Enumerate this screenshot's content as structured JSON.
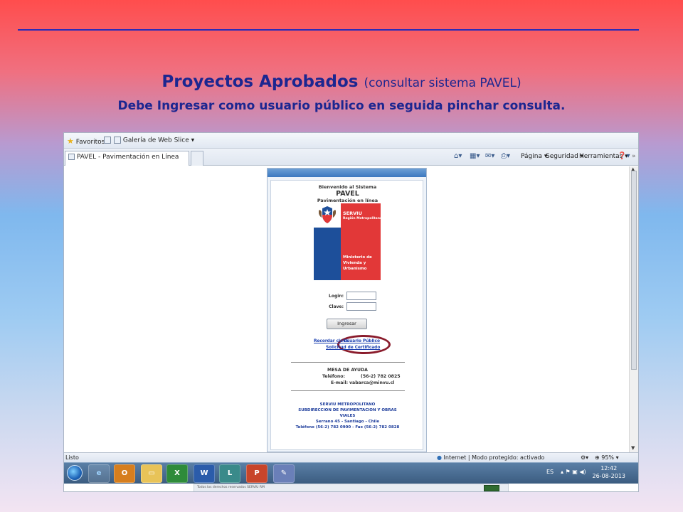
{
  "slide": {
    "title": "Proyectos Aprobados",
    "title_suffix": "(consultar sistema PAVEL)",
    "subtitle": "Debe Ingresar como usuario público  en seguida pinchar consulta."
  },
  "browser": {
    "favorites_label": "Favoritos",
    "web_slice_label": "Galería de Web Slice",
    "tab_title": "PAVEL - Pavimentación en Línea",
    "commands": {
      "pagina": "Página",
      "seguridad": "Seguridad",
      "herramientas": "Herramientas"
    },
    "status_left": "Listo",
    "status_zone": "Internet | Modo protegido: activado",
    "zoom": "95%"
  },
  "page": {
    "welcome": "Bienvenido al Sistema",
    "system_name": "PAVEL",
    "system_desc": "Pavimentación en línea",
    "logo": {
      "org": "SERVIU",
      "region": "Región Metropolitana",
      "ministry": "Ministerio de Vivienda y Urbanismo",
      "colors": {
        "blue": "#1d4f9a",
        "red": "#e23838"
      }
    },
    "login_label": "Login:",
    "password_label": "Clave:",
    "submit_label": "Ingresar",
    "links": {
      "recordar": "Recordar clave",
      "publico": "Usuario Público",
      "solicitud": "Solicitud de Certificado"
    },
    "help_desk": {
      "title": "MESA DE AYUDA",
      "phone_label": "Teléfono:",
      "phone": "(56-2) 782 0825",
      "email_label": "E-mail:",
      "email": "vabarca@minvu.cl"
    },
    "footer": {
      "line1": "SERVIU METROPOLITANO",
      "line2": "SUBDIRECCION DE PAVIMENTACION Y OBRAS",
      "line3": "VIALES",
      "line4": "Serrano 45 - Santiago - Chile",
      "line5": "Teléfono (56-2) 782 0900 - Fax (56-2) 782 0828"
    },
    "copyright": "Todos los derechos reservados SERVIU RM"
  },
  "taskbar": {
    "language": "ES",
    "time": "12:42",
    "date": "26-08-2013"
  }
}
